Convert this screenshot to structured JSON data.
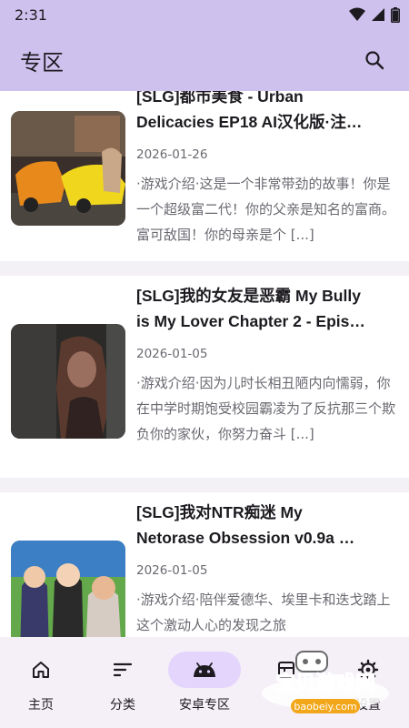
{
  "status": {
    "time": "2:31"
  },
  "app_bar": {
    "title": "专区"
  },
  "cards": [
    {
      "title_lines": [
        "[SLG]都市美食 - Urban",
        "Delicacies  EP18 AI汉化版·注…"
      ],
      "date": "2026-01-26",
      "desc": "·游戏介绍·这是一个非常带劲的故事！你是一个超级富二代！你的父亲是知名的富商。富可敌国！你的母亲是个 [...]"
    },
    {
      "title_lines": [
        "[SLG]我的女友是恶霸   My Bully",
        "is My Lover   Chapter 2 - Epis…"
      ],
      "date": "2026-01-05",
      "desc": "·游戏介绍·因为儿时长相丑陋内向懦弱，你在中学时期饱受校园霸凌为了反抗那三个欺负你的家伙，你努力奋斗 [...]"
    },
    {
      "title_lines": [
        "[SLG]我对NTR痴迷   My",
        "Netorase Obsession    v0.9a …"
      ],
      "date": "2026-01-05",
      "desc": "·游戏介绍·陪伴爱德华、埃里卡和迭戈踏上这个激动人心的发现之旅"
    }
  ],
  "nav": [
    {
      "label": "主页",
      "icon": "home-icon"
    },
    {
      "label": "分类",
      "icon": "sort-icon"
    },
    {
      "label": "安卓专区",
      "icon": "android-icon"
    },
    {
      "label": "",
      "icon": "grid-icon"
    },
    {
      "label": "设置",
      "icon": "gear-icon"
    }
  ],
  "watermark": {
    "text": "宝贝游戏网",
    "url": "baobeiy.com"
  },
  "colors": {
    "app_bar": "#cfc1ee",
    "nav_active": "#e3d5fb",
    "nav_bg": "#f5eff8"
  }
}
